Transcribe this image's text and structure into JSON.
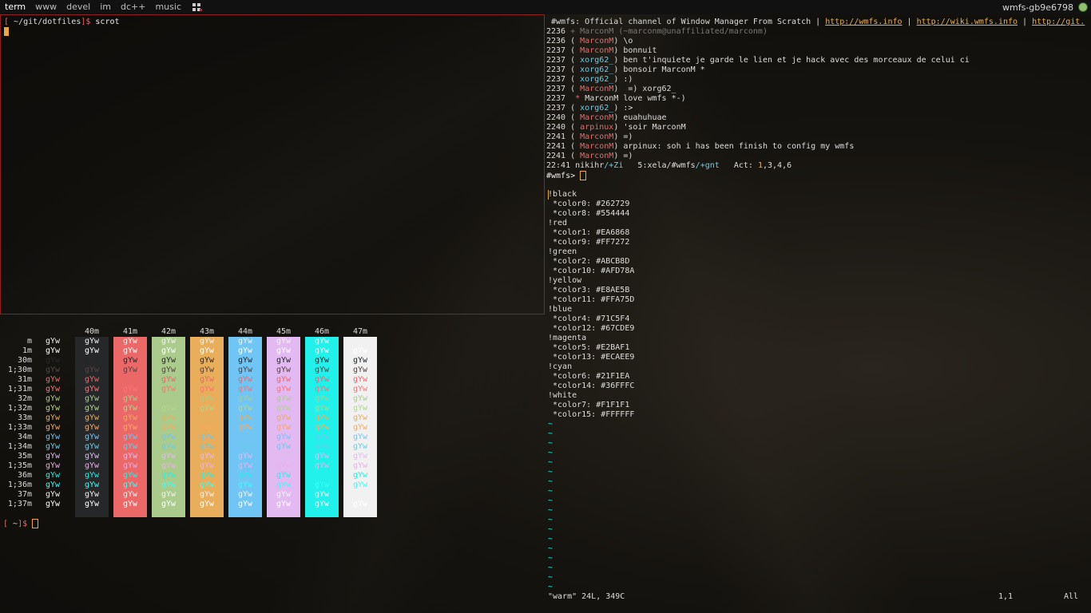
{
  "topbar": {
    "tags": [
      "term",
      "www",
      "devel",
      "im",
      "dc++",
      "music"
    ],
    "active_tag": "term",
    "status": "wmfs-gb9e6798"
  },
  "left_terminal": {
    "prompt_open": "[",
    "prompt_path": " ~/git/dotfiles",
    "prompt_close": "]$",
    "command": " scrot"
  },
  "color_table": {
    "bg_headers": [
      "40m",
      "41m",
      "42m",
      "43m",
      "44m",
      "45m",
      "46m",
      "47m"
    ],
    "row_labels": [
      "m",
      "1m",
      "30m",
      "1;30m",
      "31m",
      "1;31m",
      "32m",
      "1;32m",
      "33m",
      "1;33m",
      "34m",
      "1;34m",
      "35m",
      "1;35m",
      "36m",
      "1;36m",
      "37m",
      "1;37m"
    ],
    "sample_text": "gYw",
    "bg_colors": [
      "#262729",
      "#ea6868",
      "#abcb8d",
      "#e8ae5b",
      "#71c5f4",
      "#e2baf1",
      "#21f1ea",
      "#f1f1f1"
    ],
    "fg_colors": [
      "#f1f1f1",
      "#ffffff",
      "#262729",
      "#554444",
      "#ea6868",
      "#ff7272",
      "#abcb8d",
      "#afd78a",
      "#e8ae5b",
      "#ffa75d",
      "#71c5f4",
      "#67cde9",
      "#e2baf1",
      "#ecaee9",
      "#21f1ea",
      "#36fffc",
      "#f1f1f1",
      "#ffffff"
    ]
  },
  "bottom_prompt": {
    "open": "[",
    "path": " ~",
    "close": "]$"
  },
  "irc": {
    "topic_channel": " #wmfs:",
    "topic_text": " Official channel of Window Manager From Scratch | ",
    "topic_link1": "http://wmfs.info",
    "topic_sep": " | ",
    "topic_link2": "http://wiki.wmfs.info",
    "topic_sep2": " | ",
    "topic_link3": "http://git.",
    "lines": [
      {
        "time": "2236",
        "mark": " + ",
        "nick": "MarconM",
        "msg": " (~marconm@unaffiliated/marconm)",
        "style": "join"
      },
      {
        "time": "2236",
        "mark": " ( ",
        "nick": "MarconM",
        "msg": ") \\o",
        "style": "red"
      },
      {
        "time": "2237",
        "mark": " ( ",
        "nick": "MarconM",
        "msg": ") bonnuit",
        "style": "red"
      },
      {
        "time": "2237",
        "mark": " ( ",
        "nick": "xorg62_",
        "msg": ") ben t'inquiete je garde le lien et je hack avec des morceaux de celui ci",
        "style": "cyan"
      },
      {
        "time": "2237",
        "mark": " ( ",
        "nick": "xorg62_",
        "msg": ") bonsoir MarconM *",
        "style": "cyan"
      },
      {
        "time": "2237",
        "mark": " ( ",
        "nick": "xorg62_",
        "msg": ") :)",
        "style": "cyan"
      },
      {
        "time": "2237",
        "mark": " ( ",
        "nick": "MarconM",
        "msg": ")  =) xorg62_",
        "style": "red"
      },
      {
        "time": "2237",
        "mark": "  * ",
        "nick": "MarconM",
        "msg": " love wmfs *-)",
        "style": "action"
      },
      {
        "time": "2237",
        "mark": " ( ",
        "nick": "xorg62_",
        "msg": ") :>",
        "style": "cyan"
      },
      {
        "time": "2240",
        "mark": " ( ",
        "nick": "MarconM",
        "msg": ") euahuhuae",
        "style": "red"
      },
      {
        "time": "2240",
        "mark": " ( ",
        "nick": "arpinux",
        "msg": ") 'soir MarconM",
        "style": "red"
      },
      {
        "time": "2241",
        "mark": " ( ",
        "nick": "MarconM",
        "msg": ") =)",
        "style": "red"
      },
      {
        "time": "2241",
        "mark": " ( ",
        "nick": "MarconM",
        "msg": ") arpinux: soh i has been finish to config my wmfs",
        "style": "red"
      },
      {
        "time": "2241",
        "mark": " ( ",
        "nick": "MarconM",
        "msg": ") =)",
        "style": "red"
      }
    ],
    "statusline": {
      "time": "22:41",
      "nick": " nikihr",
      "mode": "/+Zi",
      "window": "   5:xela/#wmfs",
      "chanmode": "/+gnt",
      "act_label": "   Act: ",
      "act_first": "1",
      "act_rest": ",3,4,6"
    },
    "input_prompt": "#wmfs>"
  },
  "vim": {
    "lines": [
      "!black",
      " *color0: #262729",
      " *color8: #554444",
      "!red",
      " *color1: #EA6868",
      " *color9: #FF7272",
      "!green",
      " *color2: #ABCB8D",
      " *color10: #AFD78A",
      "!yellow",
      " *color3: #E8AE5B",
      " *color11: #FFA75D",
      "!blue",
      " *color4: #71C5F4",
      " *color12: #67CDE9",
      "!magenta",
      " *color5: #E2BAF1",
      " *color13: #ECAEE9",
      "!cyan",
      " *color6: #21F1EA",
      " *color14: #36FFFC",
      "!white",
      " *color7: #F1F1F1",
      " *color15: #FFFFFF"
    ],
    "tilde": "~",
    "status_file": "\"warm\" 24L, 349C",
    "status_pos": "1,1",
    "status_scroll": "All"
  }
}
